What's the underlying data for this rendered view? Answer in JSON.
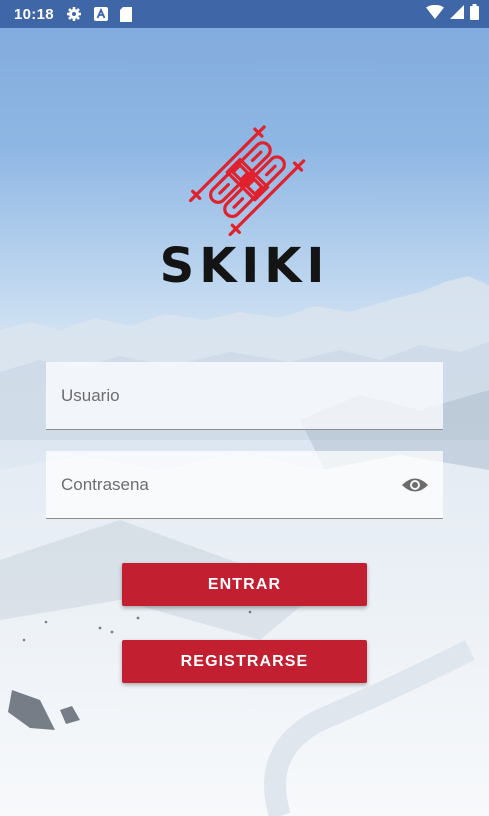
{
  "status_bar": {
    "time": "10:18",
    "left_icons": [
      "settings-icon",
      "a-badge-icon",
      "sd-card-icon"
    ],
    "right_icons": [
      "wifi-icon",
      "signal-icon",
      "battery-icon"
    ]
  },
  "brand": {
    "logo_icon": "skis-and-poles-icon",
    "name": "SKIKI"
  },
  "login_form": {
    "username_placeholder": "Usuario",
    "password_placeholder": "Contrasena",
    "password_toggle_icon": "eye-icon"
  },
  "buttons": {
    "login_label": "ENTRAR",
    "register_label": "REGISTRARSE"
  },
  "colors": {
    "status_bar": "#3f67a8",
    "accent": "#c21f30",
    "logo": "#e0212e",
    "brand_text": "#141414"
  }
}
